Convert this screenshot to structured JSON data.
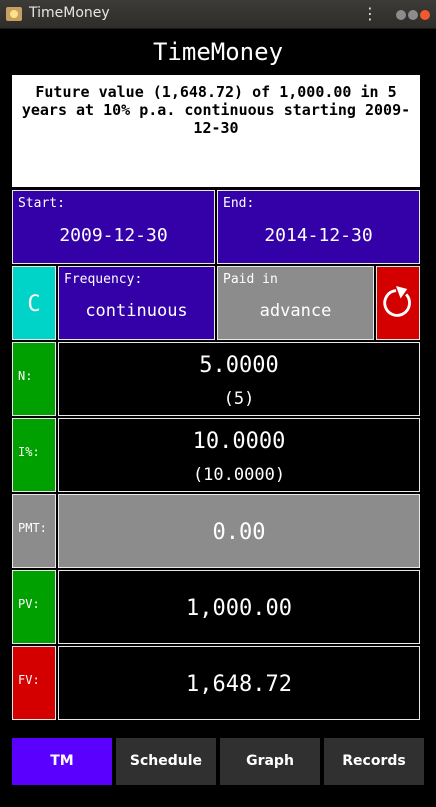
{
  "window": {
    "title": "TimeMoney"
  },
  "app": {
    "title": "TimeMoney"
  },
  "summary": {
    "text": "Future value (1,648.72) of 1,000.00 in 5 years at 10% p.a. continuous starting 2009-12-30"
  },
  "dates": {
    "start": {
      "label": "Start:",
      "value": "2009-12-30"
    },
    "end": {
      "label": "End:",
      "value": "2014-12-30"
    }
  },
  "controls": {
    "clear_label": "C",
    "frequency": {
      "label": "Frequency:",
      "value": "continuous"
    },
    "paid_in": {
      "label": "Paid in",
      "value": "advance"
    },
    "reset_icon": "refresh-icon"
  },
  "rows": {
    "n": {
      "label": "N:",
      "value": "5.0000",
      "sub": "(5)"
    },
    "i": {
      "label": "I%:",
      "value": "10.0000",
      "sub": "(10.0000)"
    },
    "pmt": {
      "label": "PMT:",
      "value": "0.00"
    },
    "pv": {
      "label": "PV:",
      "value": "1,000.00"
    },
    "fv": {
      "label": "FV:",
      "value": "1,648.72"
    }
  },
  "tabs": [
    {
      "label": "TM",
      "active": true
    },
    {
      "label": "Schedule",
      "active": false
    },
    {
      "label": "Graph",
      "active": false
    },
    {
      "label": "Records",
      "active": false
    }
  ],
  "colors": {
    "purple": "#3400a8",
    "green": "#00a000",
    "red": "#d40000",
    "gray": "#8c8c8c",
    "teal": "#00d4c8",
    "active_tab": "#5a00ff"
  }
}
